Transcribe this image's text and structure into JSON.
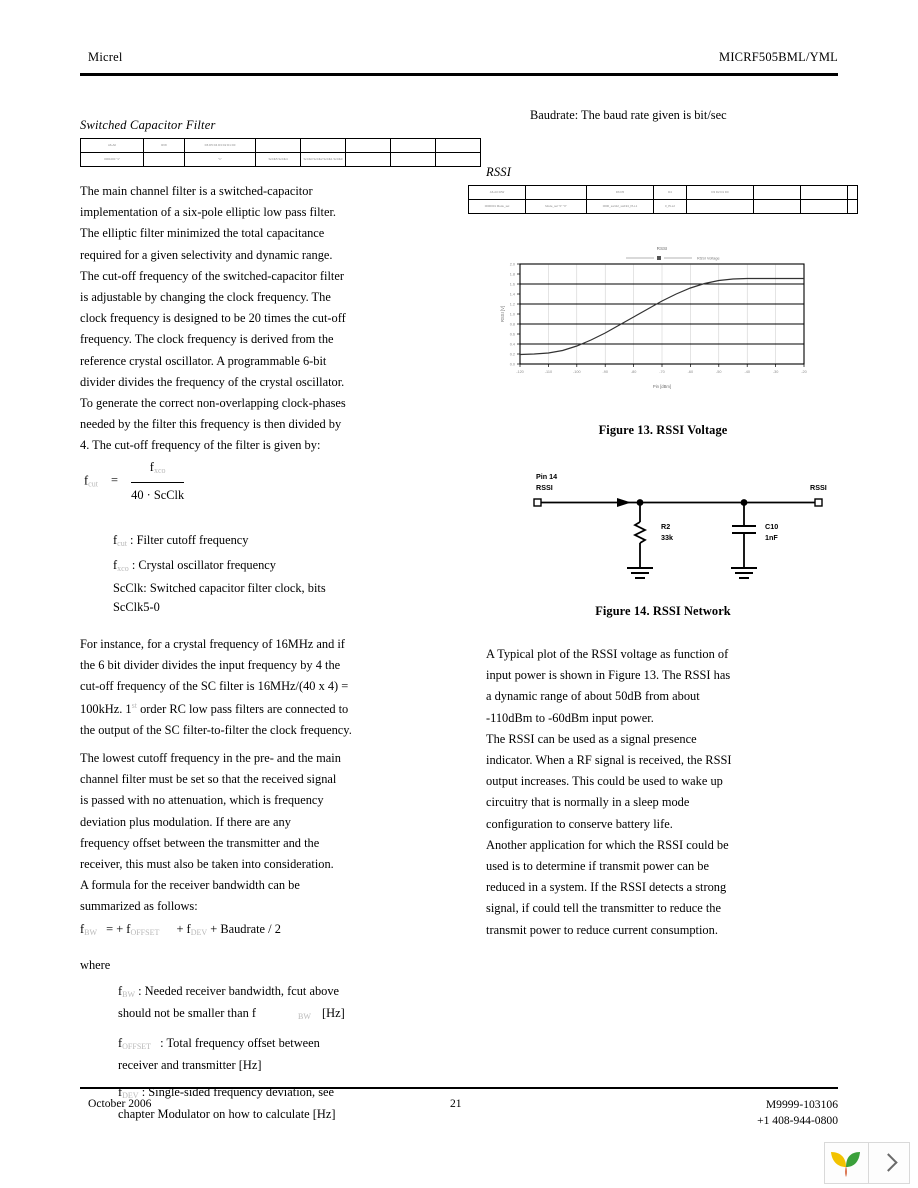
{
  "header": {
    "company": "Micrel",
    "part_number": "MICRF505BML/YML"
  },
  "left_column": {
    "section_title": "Switched Capacitor Filter",
    "register_table": {
      "rows": [
        [
          "A6-A0",
          "R/W",
          "D6 D5 D4 D3 D2 D1 D0",
          "",
          "",
          "",
          "",
          "",
          ""
        ],
        [
          "0001000 \"1\"",
          "",
          "\"1\"",
          "ScClk5 ScClk4",
          "ScClk3 ScClk2 ScClk1 ScClk0",
          "",
          "",
          "",
          ""
        ]
      ]
    },
    "paragraph_1": "The main channel filter is a switched-capacitor implementation of a six-pole elliptic low pass filter. The elliptic filter minimized the total capacitance required for a given selectivity and dynamic range. The cut-off frequency of the switched-capacitor filter is adjustable by changing the clock frequency. The clock frequency is designed to be 20 times the cut-off frequency. The clock frequency is derived from the reference crystal oscillator. A programmable 6-bit divider divides the frequency of the crystal oscillator. To generate the correct non-overlapping clock-phases needed by the filter this frequency is then divided by 4. The cut-off frequency of the filter is given by:",
    "formula_cutoff": {
      "lhs_base": "f",
      "lhs_sub": "cut",
      "equals": "=",
      "numerator_base": "f",
      "numerator_sub": "xco",
      "denominator": "40   ·  ScClk"
    },
    "definitions": [
      {
        "symbol": "f",
        "sub": "cut",
        "text": ": Filter cutoff frequency"
      },
      {
        "symbol": "f",
        "sub": "xco",
        "text": ": Crystal oscillator frequency"
      }
    ],
    "scclk_definition_line1": "ScClk: Switched capacitor filter clock, bits",
    "scclk_definition_line2": "ScClk5-0",
    "paragraph_2_part1": "For instance, for a crystal frequency of 16MHz and if the 6 bit divider divides the input frequency by 4 the cut-off frequency of the SC filter is 16MHz/(40 x 4) = 100kHz. 1",
    "paragraph_2_sup": "st",
    "paragraph_2_part2": "order RC low pass filters are connected to the output of the SC filter-to-filter the clock frequency.",
    "paragraph_3": "The lowest cutoff frequency in the pre- and the main channel filter must be set so that the received signal is passed with no attenuation, which is frequency deviation plus modulation. If there are any frequency offset between the transmitter and the receiver, this must also be taken into consideration. A formula for the receiver bandwidth can be summarized as follows:",
    "formula_bandwidth": {
      "lhs_base": "f",
      "lhs_sub": "BW",
      "rest_1": "=  + f",
      "sub_1": "OFFSET",
      "rest_2": "+ f",
      "sub_2": "DEV",
      "rest_3": "+  Baudrate / 2"
    },
    "where_label": "where",
    "where_items": [
      {
        "symbol": "f",
        "sub": "BW",
        "line1": ": Needed receiver bandwidth, fcut above",
        "line2_pre": "should not be smaller than f",
        "line2_sub": "BW",
        "line2_post": "[Hz]"
      },
      {
        "symbol": "f",
        "sub": "OFFSET",
        "line1": ": Total frequency offset between",
        "line2_pre": "receiver and transmitter [Hz]",
        "line2_sub": "",
        "line2_post": ""
      },
      {
        "symbol": "f",
        "sub": "DEV",
        "line1": ": Single-sided frequency deviation, see",
        "line2_pre": "chapter Modulator on how to calculate [Hz]",
        "line2_sub": "",
        "line2_post": ""
      }
    ]
  },
  "right_column": {
    "baudrate_note": "Baudrate: The baud rate given is bit/sec",
    "section_title": "RSSI",
    "register_table": {
      "rows": [
        [
          "A6-A0 R/W",
          "",
          "D6 D5",
          "D4",
          "D3 D2 D1 D0",
          "",
          "",
          ""
        ],
        [
          "0000001 Mode_sel",
          "Mode_sel \"0\" \"0\"",
          "0000_sw112_sw194_PLL1",
          "0_PLL2",
          "",
          "",
          "",
          ""
        ]
      ]
    },
    "figure13_caption": "Figure 13. RSSI Voltage",
    "figure14_caption": "Figure 14. RSSI Network",
    "schematic": {
      "pin_label_line1": "Pin 14",
      "pin_label_line2": "RSSI",
      "right_label": "RSSI",
      "r_ref": "R2",
      "r_value": "33k",
      "c_ref": "C10",
      "c_value": "1nF"
    },
    "paragraph_1": "A Typical plot of the RSSI voltage as function of input power is shown in Figure 13. The RSSI has a dynamic range of about 50dB from about -110dBm to -60dBm input power.",
    "paragraph_2": "The RSSI can be used as a signal presence indicator. When a RF signal is received, the RSSI output increases. This could be used to wake up circuitry that is normally in a sleep mode configuration to conserve battery life.",
    "paragraph_3": "Another application for which the RSSI could be used is to determine if transmit power can be reduced in a system. If the RSSI detects a strong signal, if could tell the transmitter to reduce the transmit power to reduce current consumption."
  },
  "chart_data": {
    "type": "line",
    "title": "RSSI",
    "legend": [
      "RSSI Voltage"
    ],
    "legend_position": "top",
    "xlabel": "Pin [dBm]",
    "ylabel": "RSSI [V]",
    "xlim": [
      -120,
      -20
    ],
    "ylim": [
      0,
      2.0
    ],
    "xticks": [
      -120,
      -110,
      -100,
      -90,
      -80,
      -70,
      -60,
      -50,
      -40,
      -30,
      -20
    ],
    "yticks": [
      0,
      0.2,
      0.4,
      0.6,
      0.8,
      1.0,
      1.2,
      1.4,
      1.6,
      1.8,
      2.0
    ],
    "grid": true,
    "x": [
      -120,
      -115,
      -110,
      -105,
      -100,
      -95,
      -90,
      -85,
      -80,
      -75,
      -70,
      -65,
      -60,
      -55,
      -50,
      -45,
      -40,
      -35,
      -30,
      -25,
      -20
    ],
    "series": [
      {
        "name": "RSSI Voltage",
        "values": [
          0.19,
          0.2,
          0.22,
          0.27,
          0.36,
          0.48,
          0.62,
          0.78,
          0.94,
          1.1,
          1.26,
          1.4,
          1.52,
          1.61,
          1.67,
          1.7,
          1.71,
          1.71,
          1.71,
          1.71,
          1.71
        ]
      }
    ]
  },
  "footer": {
    "date": "October 2006",
    "page_number": "21",
    "doc_number": "M9999-103106",
    "phone": "+1 408-944-0800"
  },
  "nav_widget": {
    "logo_name": "micrel-leaf-logo",
    "next_label": "next-page"
  }
}
